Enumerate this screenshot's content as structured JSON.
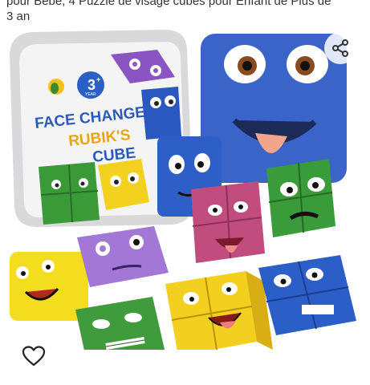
{
  "title_line1": "pour Bébé, 4 Puzzle de visage cubes pour Enfant de Plus de",
  "title_line2": "3 an",
  "box": {
    "brand_line1": "FACE CHANGE",
    "brand_line2": "RUBIK'S",
    "brand_line3": "CUBE",
    "age_number": "3",
    "age_plus": "+",
    "age_label": "YEAR"
  },
  "icons": {
    "share": "share-icon",
    "favorite": "heart-icon"
  },
  "colors": {
    "blue": "#2f5fc4",
    "yellow": "#f2d21f",
    "green": "#3e9a3a",
    "purple": "#9a6bc9",
    "pink": "#c24f7f"
  }
}
